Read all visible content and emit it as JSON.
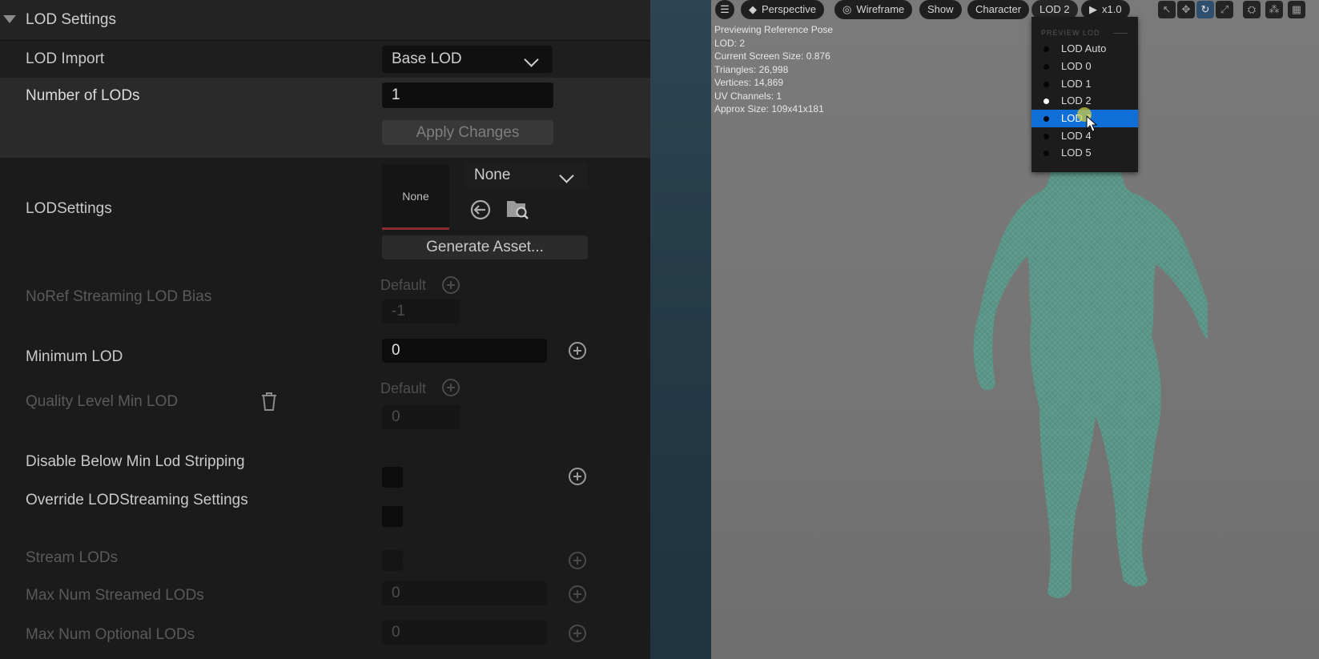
{
  "details": {
    "section_title": "LOD Settings",
    "lod_import": {
      "label": "LOD Import",
      "value": "Base LOD"
    },
    "num_lods": {
      "label": "Number of LODs",
      "value": "1"
    },
    "apply_button": "Apply Changes",
    "lod_settings": {
      "label": "LODSettings",
      "thumb_text": "None",
      "asset_value": "None",
      "generate_button": "Generate Asset..."
    },
    "noref_bias": {
      "label": "NoRef Streaming LOD Bias",
      "default_label": "Default",
      "value": "-1"
    },
    "minimum_lod": {
      "label": "Minimum LOD",
      "value": "0"
    },
    "quality_min_lod": {
      "label": "Quality Level Min LOD",
      "default_label": "Default",
      "value": "0"
    },
    "disable_below": {
      "label": "Disable Below Min Lod Stripping"
    },
    "override_streaming": {
      "label": "Override LODStreaming Settings"
    },
    "stream_lods": {
      "label": "Stream LODs"
    },
    "max_streamed": {
      "label": "Max Num Streamed LODs",
      "value": "0"
    },
    "max_optional": {
      "label": "Max Num Optional LODs",
      "value": "0"
    }
  },
  "viewport": {
    "toolbar": {
      "perspective": "Perspective",
      "wireframe": "Wireframe",
      "show": "Show",
      "character": "Character",
      "lod": "LOD 2",
      "play_speed": "x1.0"
    },
    "info_lines": [
      "Previewing Reference Pose",
      "LOD: 2",
      "Current Screen Size: 0.876",
      "Triangles: 26,998",
      "Vertices: 14,869",
      "UV Channels: 1",
      "Approx Size: 109x41x181"
    ],
    "lod_menu": {
      "header": "PREVIEW LOD",
      "items": [
        "LOD Auto",
        "LOD 0",
        "LOD 1",
        "LOD 2",
        "LOD 3",
        "LOD 4",
        "LOD 5"
      ],
      "current": "LOD 2",
      "hovered": "LOD 3"
    }
  },
  "colors": {
    "panel_bg": "#1b1b1b",
    "viewport_bg": "#777777",
    "mesh_color": "#5f9e8f",
    "selection": "#0f6fd6"
  }
}
